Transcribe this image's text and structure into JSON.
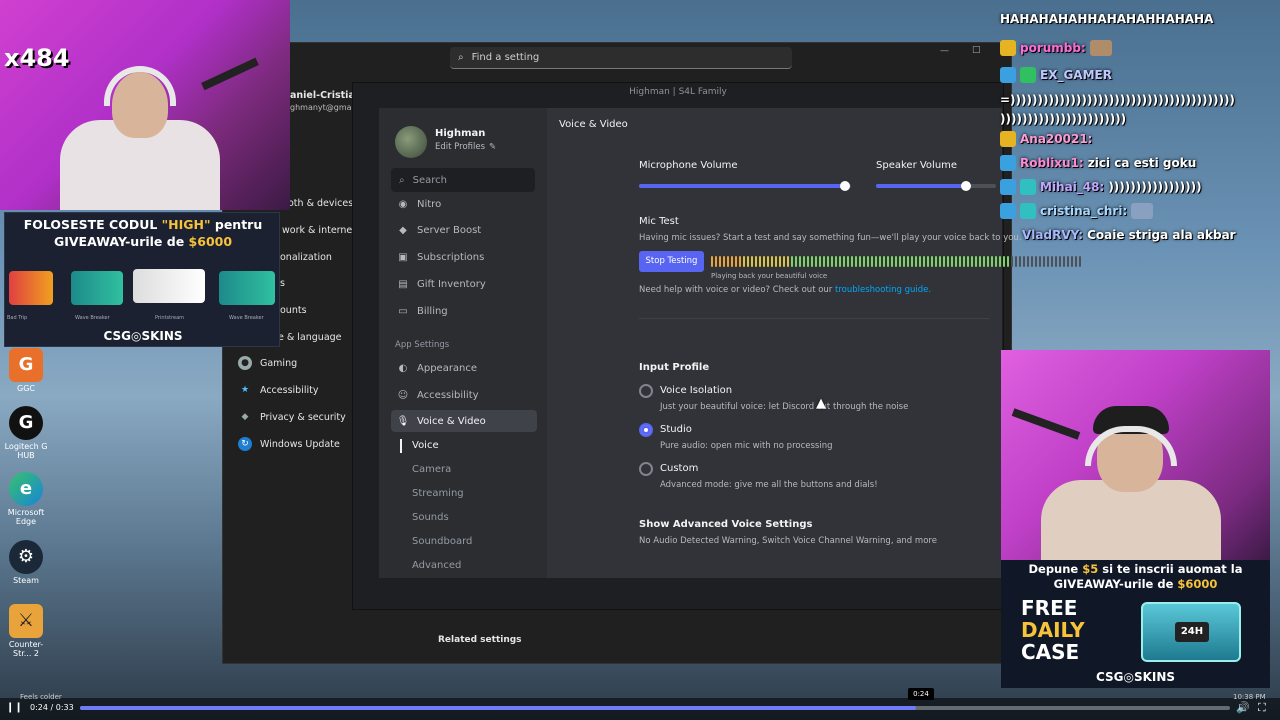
{
  "windows_settings": {
    "search_placeholder": "Find a setting",
    "user_fragment": "aniel-Cristian N",
    "email_fragment": "ghmanyt@gmail.c",
    "fragments": [
      "oth & devices",
      "work & internet",
      "onalization",
      "s",
      "ounts",
      "e & language"
    ],
    "items": [
      {
        "label": "Gaming"
      },
      {
        "label": "Accessibility"
      },
      {
        "label": "Privacy & security"
      },
      {
        "label": "Windows Update"
      }
    ],
    "related_settings": "Related settings"
  },
  "discord": {
    "window_title": "Highman | S4L Family",
    "profile": {
      "name": "Highman",
      "edit": "Edit Profiles"
    },
    "search_placeholder": "Search",
    "nav": [
      {
        "label": "Nitro"
      },
      {
        "label": "Server Boost"
      },
      {
        "label": "Subscriptions"
      },
      {
        "label": "Gift Inventory"
      },
      {
        "label": "Billing"
      }
    ],
    "app_settings_header": "App Settings",
    "app_nav": [
      {
        "label": "Appearance"
      },
      {
        "label": "Accessibility"
      },
      {
        "label": "Voice & Video"
      }
    ],
    "sub_nav": [
      {
        "label": "Voice"
      },
      {
        "label": "Camera"
      },
      {
        "label": "Streaming"
      },
      {
        "label": "Sounds"
      },
      {
        "label": "Soundboard"
      },
      {
        "label": "Advanced"
      }
    ],
    "page_title": "Voice & Video",
    "mic_volume_label": "Microphone Volume",
    "speaker_volume_label": "Speaker Volume",
    "mic_volume_level": 0.97,
    "speaker_volume_level": 0.75,
    "mic_test": {
      "title": "Mic Test",
      "desc": "Having mic issues? Start a test and say something fun—we'll play your voice back to you.",
      "button": "Stop Testing",
      "playing": "Playing back your beautiful voice",
      "help_prefix": "Need help with voice or video? Check out our ",
      "help_link": "troubleshooting guide."
    },
    "input_profile": {
      "title": "Input Profile",
      "options": [
        {
          "label": "Voice Isolation",
          "desc": "Just your beautiful voice: let Discord cut through the noise",
          "selected": false
        },
        {
          "label": "Studio",
          "desc": "Pure audio: open mic with no processing",
          "selected": true
        },
        {
          "label": "Custom",
          "desc": "Advanced mode: give me all the buttons and dials!",
          "selected": false
        }
      ]
    },
    "advanced": {
      "title": "Show Advanced Voice Settings",
      "desc": "No Audio Detected Warning, Switch Voice Channel Warning, and more"
    },
    "accent": "#5865f2"
  },
  "desktop_icons": [
    {
      "label": "GGC"
    },
    {
      "label": "Logitech G HUB"
    },
    {
      "label": "Microsoft Edge"
    },
    {
      "label": "Steam"
    },
    {
      "label": "Counter-Str... 2"
    }
  ],
  "stream": {
    "sub_count": "x484",
    "promo_top": {
      "line1_a": "FOLOSESTE CODUL ",
      "line1_code": "\"HIGH\"",
      "line1_b": " pentru",
      "line2_a": "GIVEAWAY-urile de ",
      "line2_amount": "$6000",
      "skins": [
        "Bad Trip",
        "Wave Breaker",
        "Printstream",
        "Wave Breaker"
      ],
      "brand": "CSG◎SKINS"
    },
    "promo_bottom": {
      "line1_a": "Depune ",
      "line1_amount": "$5",
      "line1_b": " si te inscrii auomat la",
      "line2_a": "GIVEAWAY-urile de ",
      "line2_amount": "$6000",
      "free": "FREE",
      "daily": "DAILY",
      "case": "CASE",
      "box_label": "24H",
      "brand": "CSG◎SKINS"
    }
  },
  "chat": [
    {
      "user": "",
      "text": "HAHAHAHAHHAHAHAHHAHAHA"
    },
    {
      "user": "porumbb:",
      "text": ""
    },
    {
      "user": "EX_GAMER",
      "text": ""
    },
    {
      "user": "",
      "text": "=)))))))))))))))))))))))))))))))))))))))))"
    },
    {
      "user": "",
      "text": ")))))))))))))))))))))))"
    },
    {
      "user": "Ana20021:",
      "text": ""
    },
    {
      "user": "Roblixu1:",
      "text": "zici ca esti goku"
    },
    {
      "user": "Mihai_48:",
      "text": ")))))))))))))))))"
    },
    {
      "user": "cristina_chri:",
      "text": ""
    },
    {
      "user": "VladRVY:",
      "text": "Coaie striga ala akbar"
    }
  ],
  "player": {
    "time": "0:24 / 0:33",
    "tooltip": "0:24",
    "progress": 0.727,
    "now_playing": "Feels colder",
    "clock": "10:38 PM"
  }
}
